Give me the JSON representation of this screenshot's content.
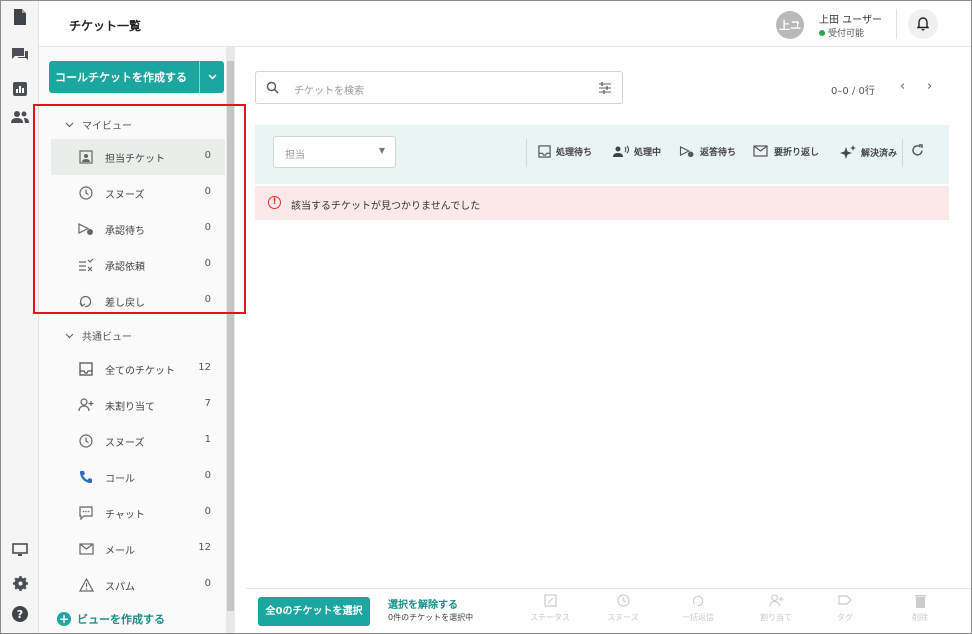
{
  "header": {
    "title": "チケット一覧",
    "avatar_initials": "上ユ",
    "user_name": "上田 ユーザー",
    "user_status": "受付可能"
  },
  "sidebar": {
    "create_call_button": "コールチケットを作成する",
    "my_view": {
      "heading": "マイビュー",
      "items": [
        {
          "label": "担当チケット",
          "count": "0",
          "icon": "assigned-ticket-icon"
        },
        {
          "label": "スヌーズ",
          "count": "0",
          "icon": "clock-icon"
        },
        {
          "label": "承認待ち",
          "count": "0",
          "icon": "approval-pending-icon"
        },
        {
          "label": "承認依頼",
          "count": "0",
          "icon": "approval-request-icon"
        },
        {
          "label": "差し戻し",
          "count": "0",
          "icon": "sendback-icon"
        }
      ]
    },
    "common_view": {
      "heading": "共通ビュー",
      "items": [
        {
          "label": "全てのチケット",
          "count": "12",
          "icon": "inbox-icon"
        },
        {
          "label": "未割り当て",
          "count": "7",
          "icon": "user-plus-icon"
        },
        {
          "label": "スヌーズ",
          "count": "1",
          "icon": "clock-icon"
        },
        {
          "label": "コール",
          "count": "0",
          "icon": "phone-icon"
        },
        {
          "label": "チャット",
          "count": "0",
          "icon": "chat-icon"
        },
        {
          "label": "メール",
          "count": "12",
          "icon": "mail-icon"
        },
        {
          "label": "スパム",
          "count": "0",
          "icon": "warning-icon"
        }
      ]
    },
    "create_view": "ビューを作成する"
  },
  "search": {
    "placeholder": "チケットを検索"
  },
  "pager": {
    "range": "0–0 / 0行"
  },
  "toolbar": {
    "assignee_placeholder": "担当",
    "statuses": [
      "処理待ち",
      "処理中",
      "返答待ち",
      "要折り返し",
      "解決済み"
    ]
  },
  "error": {
    "message": "該当するチケットが見つかりませんでした"
  },
  "bottom": {
    "select_all": "全0のチケットを選択",
    "deselect": "選択を解除する",
    "selected_count": "0件のチケットを選択中",
    "actions": [
      "ステータス",
      "スヌーズ",
      "一括返信",
      "割り当て",
      "タグ",
      "削除"
    ]
  },
  "colors": {
    "accent": "#1ba6a0",
    "highlight": "#e3141f",
    "error_bg": "#fbe9e9",
    "toolbar_bg": "#e8f5f4"
  }
}
